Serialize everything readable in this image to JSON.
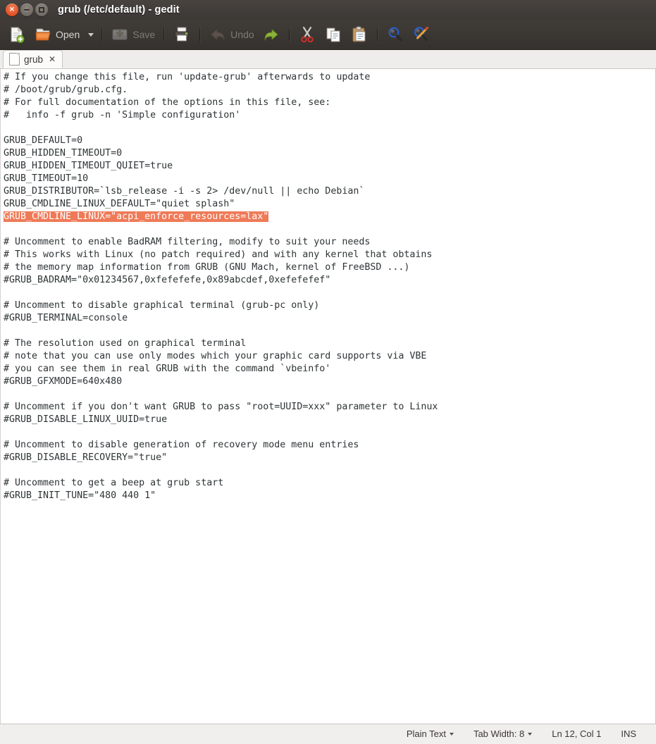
{
  "window": {
    "title": "grub (/etc/default) - gedit",
    "controls": [
      {
        "name": "close",
        "glyph": "×"
      },
      {
        "name": "minimize",
        "glyph": ""
      },
      {
        "name": "maximize",
        "glyph": ""
      }
    ]
  },
  "toolbar": {
    "new_label": "",
    "open_label": "Open",
    "save_label": "Save",
    "print_label": "",
    "undo_label": "Undo",
    "redo_label": "",
    "cut_label": "",
    "copy_label": "",
    "paste_label": "",
    "find_label": "",
    "replace_label": "",
    "icons": {
      "new": "new-document-icon",
      "open": "open-folder-icon",
      "save": "save-disk-icon",
      "print": "printer-icon",
      "undo": "undo-arrow-icon",
      "redo": "redo-arrow-icon",
      "cut": "scissors-icon",
      "copy": "copy-pages-icon",
      "paste": "clipboard-icon",
      "find": "magnifier-icon",
      "replace": "magnifier-pencil-icon"
    }
  },
  "tabs": [
    {
      "label": "grub",
      "close": "✕",
      "active": true
    }
  ],
  "editor": {
    "selection_color": "#ef7a58",
    "selection_text_color": "#ffffff",
    "text_color": "#2e3436",
    "background": "#ffffff",
    "lines": [
      {
        "text": "# If you change this file, run 'update-grub' afterwards to update"
      },
      {
        "text": "# /boot/grub/grub.cfg."
      },
      {
        "text": "# For full documentation of the options in this file, see:"
      },
      {
        "text": "#   info -f grub -n 'Simple configuration'"
      },
      {
        "text": ""
      },
      {
        "text": "GRUB_DEFAULT=0"
      },
      {
        "text": "GRUB_HIDDEN_TIMEOUT=0"
      },
      {
        "text": "GRUB_HIDDEN_TIMEOUT_QUIET=true"
      },
      {
        "text": "GRUB_TIMEOUT=10"
      },
      {
        "text": "GRUB_DISTRIBUTOR=`lsb_release -i -s 2> /dev/null || echo Debian`"
      },
      {
        "text": "GRUB_CMDLINE_LINUX_DEFAULT=\"quiet splash\""
      },
      {
        "text": "GRUB_CMDLINE_LINUX=\"acpi_enforce_resources=lax\"",
        "selected": true
      },
      {
        "text": ""
      },
      {
        "text": "# Uncomment to enable BadRAM filtering, modify to suit your needs"
      },
      {
        "text": "# This works with Linux (no patch required) and with any kernel that obtains"
      },
      {
        "text": "# the memory map information from GRUB (GNU Mach, kernel of FreeBSD ...)"
      },
      {
        "text": "#GRUB_BADRAM=\"0x01234567,0xfefefefe,0x89abcdef,0xefefefef\""
      },
      {
        "text": ""
      },
      {
        "text": "# Uncomment to disable graphical terminal (grub-pc only)"
      },
      {
        "text": "#GRUB_TERMINAL=console"
      },
      {
        "text": ""
      },
      {
        "text": "# The resolution used on graphical terminal"
      },
      {
        "text": "# note that you can use only modes which your graphic card supports via VBE"
      },
      {
        "text": "# you can see them in real GRUB with the command `vbeinfo'"
      },
      {
        "text": "#GRUB_GFXMODE=640x480"
      },
      {
        "text": ""
      },
      {
        "text": "# Uncomment if you don't want GRUB to pass \"root=UUID=xxx\" parameter to Linux"
      },
      {
        "text": "#GRUB_DISABLE_LINUX_UUID=true"
      },
      {
        "text": ""
      },
      {
        "text": "# Uncomment to disable generation of recovery mode menu entries"
      },
      {
        "text": "#GRUB_DISABLE_RECOVERY=\"true\""
      },
      {
        "text": ""
      },
      {
        "text": "# Uncomment to get a beep at grub start"
      },
      {
        "text": "#GRUB_INIT_TUNE=\"480 440 1\""
      }
    ]
  },
  "statusbar": {
    "language": "Plain Text",
    "tab_width": "Tab Width: 8",
    "position": "Ln 12, Col 1",
    "insert_mode": "INS"
  }
}
